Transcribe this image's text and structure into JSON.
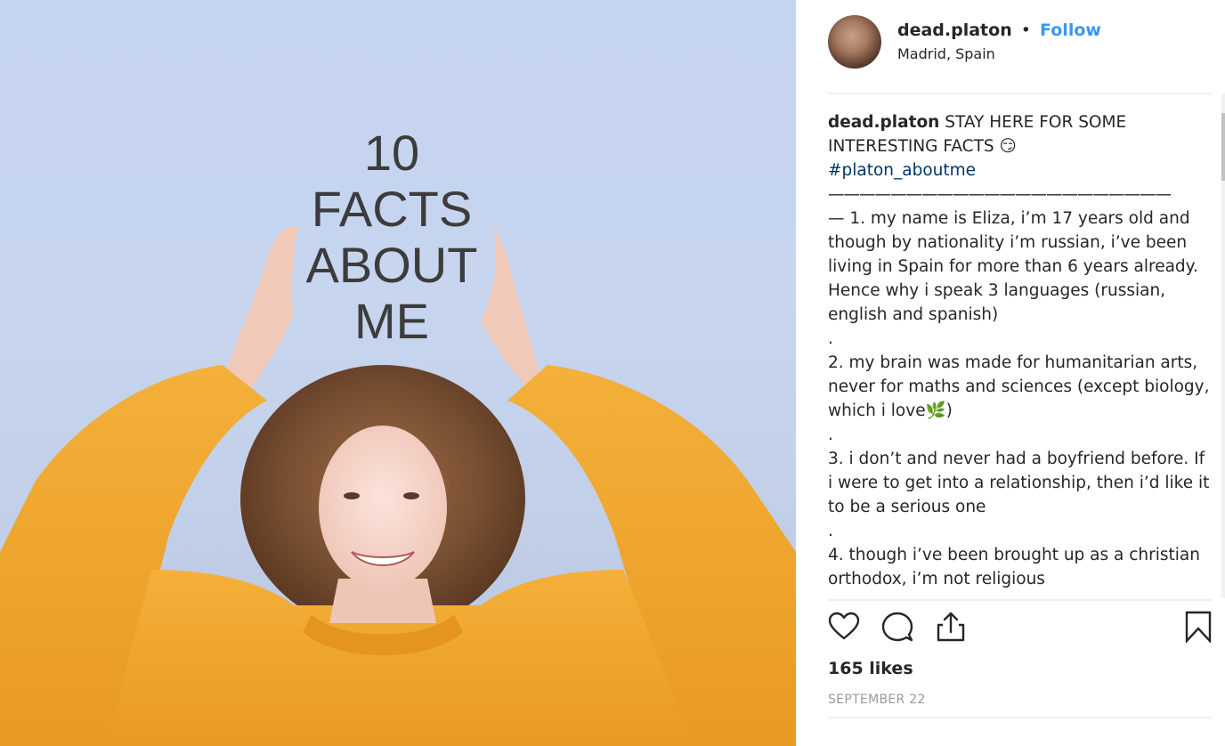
{
  "post": {
    "image": {
      "alt": "Girl in a yellow sweater holding hands up under text",
      "overlay_lines": [
        "10",
        "FACTS",
        "ABOUT",
        "ME"
      ],
      "colors": {
        "background": "#c5d4ef",
        "sweater": "#f0a82c",
        "hair": "#7a5032",
        "text": "#3c3c3c"
      }
    },
    "header": {
      "username": "dead.platon",
      "separator": "•",
      "follow_label": "Follow",
      "location": "Madrid, Spain"
    },
    "caption": {
      "username": "dead.platon",
      "text_line1": " STAY HERE FOR SOME",
      "text_line2": "INTERESTING FACTS 😏",
      "hashtag": "#platon_aboutme",
      "dashes": "——————————————————————",
      "facts": [
        "— 1. my name is Eliza, i’m 17 years old and though by nationality i’m russian, i’ve been living in Spain for more than 6 years already. Hence why i speak 3 languages (russian, english and spanish)",
        "2. my brain was made for humanitarian arts, never for maths and sciences (except biology, which i love🌿)",
        "3. i don’t and never had a boyfriend before. If i were to get into a relationship, then i’d like it to be a serious one",
        "4. though i’ve been brought up as a christian orthodox, i’m not religious"
      ],
      "separator": "."
    },
    "actions": {
      "like": "heart-icon",
      "comment": "comment-icon",
      "share": "share-icon",
      "save": "bookmark-icon"
    },
    "likes": "165 likes",
    "date": "SEPTEMBER 22",
    "colors": {
      "follow": "#3897f0",
      "hashtag": "#003569",
      "date": "#999999",
      "divider": "#efefef"
    }
  }
}
